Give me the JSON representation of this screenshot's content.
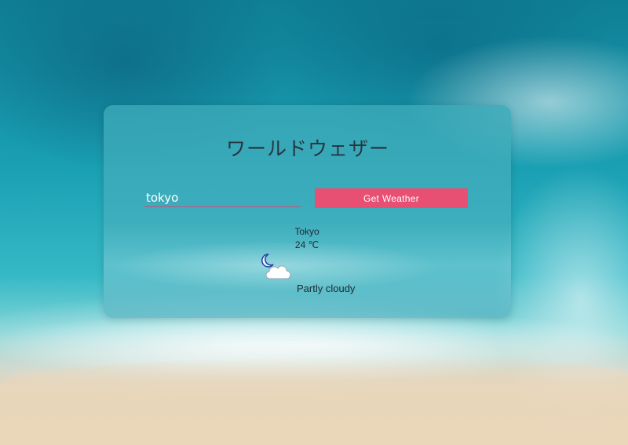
{
  "app": {
    "title": "ワールドウェザー"
  },
  "search": {
    "value": "tokyo",
    "placeholder": ""
  },
  "buttons": {
    "get_weather_label": "Get Weather"
  },
  "weather": {
    "city": "Tokyo",
    "temperature": "24 ℃",
    "condition": "Partly cloudy",
    "icon": "partly-cloudy-night-icon"
  },
  "colors": {
    "accent": "#e74f73",
    "text": "#1e2a33",
    "card_tint": "#3caab9"
  }
}
